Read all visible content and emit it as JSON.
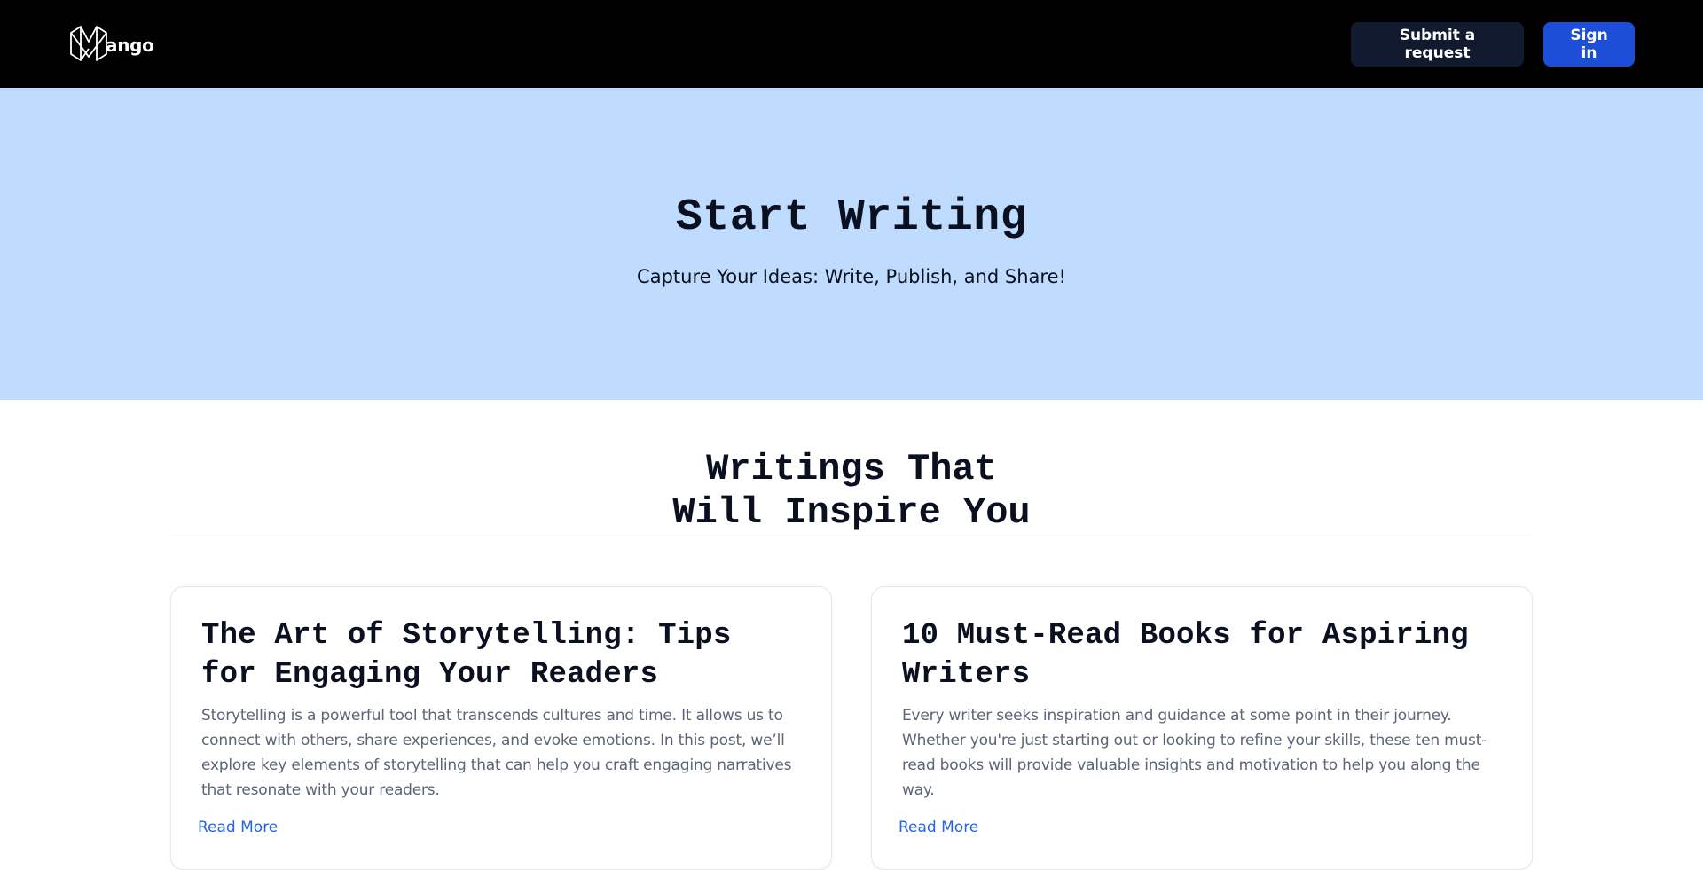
{
  "nav": {
    "brand_text": "ango",
    "submit_label": "Submit a request",
    "signin_label": "Sign in"
  },
  "hero": {
    "title": "Start Writing",
    "subtitle": "Capture Your Ideas: Write, Publish, and Share!"
  },
  "section": {
    "title_line1": "Writings That",
    "title_line2": "Will Inspire You"
  },
  "posts": [
    {
      "title": "The Art of Storytelling: Tips for Engaging Your Readers",
      "excerpt": "Storytelling is a powerful tool that transcends cultures and time. It allows us to connect with others, share experiences, and evoke emotions. In this post, we’ll explore key elements of storytelling that can help you craft engaging narratives that resonate with your readers.",
      "link_label": "Read More"
    },
    {
      "title": "10 Must-Read Books for Aspiring Writers",
      "excerpt": "Every writer seeks inspiration and guidance at some point in their journey. Whether you're just starting out or looking to refine your skills, these ten must-read books will provide valuable insights and motivation to help you along the way.",
      "link_label": "Read More"
    }
  ],
  "colors": {
    "navbar_bg": "#000000",
    "hero_bg": "#bfdbfe",
    "request_button_bg": "#111a2e",
    "signin_button_bg": "#1d4ed8",
    "link": "#2563eb"
  },
  "icons": {
    "brand_logo": "mango-m-logo-icon"
  }
}
